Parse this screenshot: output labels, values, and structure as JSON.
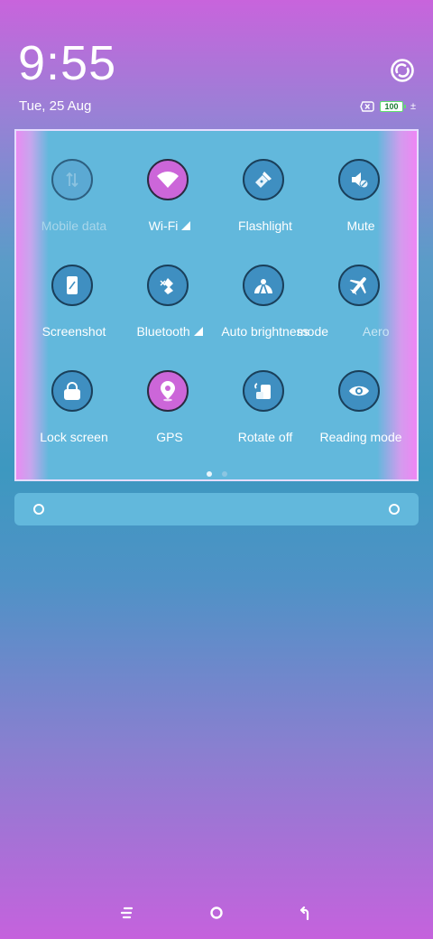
{
  "status": {
    "time": "9:55",
    "date": "Tue, 25 Aug",
    "battery_level": "100",
    "charging_symbol": "±"
  },
  "quick_settings": {
    "tiles": [
      {
        "label": "Mobile data",
        "icon": "mobile-data-icon",
        "state": "unavailable"
      },
      {
        "label": "Wi-Fi",
        "icon": "wifi-icon",
        "state": "on",
        "has_signal": true
      },
      {
        "label": "Flashlight",
        "icon": "flashlight-icon",
        "state": "off"
      },
      {
        "label": "Mute",
        "icon": "mute-icon",
        "state": "off"
      },
      {
        "label": "Screenshot",
        "icon": "screenshot-icon",
        "state": "off"
      },
      {
        "label": "Bluetooth",
        "icon": "bluetooth-icon",
        "state": "off",
        "has_signal": true
      },
      {
        "label": "Auto brightness",
        "icon": "auto-brightness-icon",
        "state": "off"
      },
      {
        "label": "Aero",
        "icon": "airplane-icon",
        "state": "off",
        "label_partial": "mode"
      },
      {
        "label": "Lock screen",
        "icon": "lock-screen-icon",
        "state": "off"
      },
      {
        "label": "GPS",
        "icon": "gps-icon",
        "state": "on"
      },
      {
        "label": "Rotate off",
        "icon": "rotate-off-icon",
        "state": "off"
      },
      {
        "label": "Reading mode",
        "icon": "reading-mode-icon",
        "state": "off"
      }
    ],
    "page_count": 2,
    "current_page": 1
  },
  "colors": {
    "tile_on": "#cc66d9",
    "tile_off": "#3f8fc1",
    "panel": "#62b8dc"
  }
}
